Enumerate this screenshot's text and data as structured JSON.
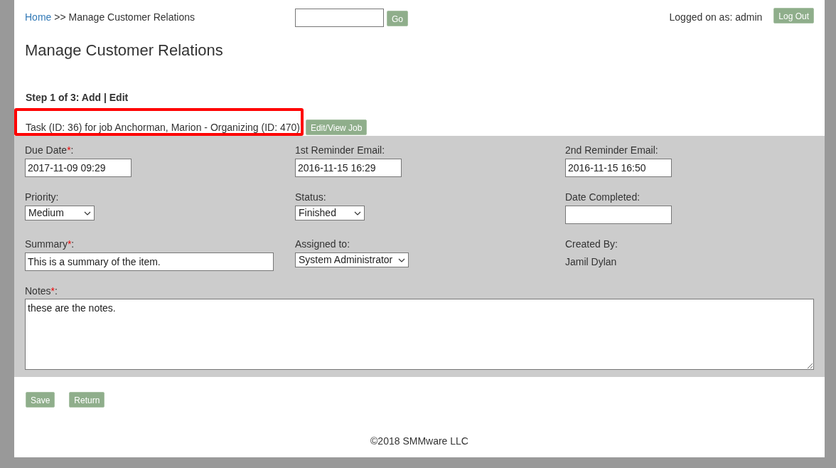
{
  "header": {
    "breadcrumb": {
      "link": "Home",
      "rest": ">> Manage Customer Relations"
    },
    "search_button": "Go",
    "login_text": "Logged on as: admin",
    "logout_button": "Log Out"
  },
  "title": "Manage Customer Relations",
  "step": "Step 1 of 3: Add | Edit",
  "task_line": {
    "text": "Task (ID: 36) for job Anchorman, Marion - Organizing (ID: 470)",
    "button": "Edit/View Job",
    "highlighted": true
  },
  "form": {
    "rows": [
      [
        {
          "kind": "text",
          "label": "Due Date",
          "required_mark": "*",
          "label_end": ":",
          "value": "2017-11-09 09:29"
        },
        {
          "kind": "text",
          "label": "1st Reminder Email:",
          "value": "2016-11-15 16:29"
        },
        {
          "kind": "text",
          "label": "2nd Reminder Email:",
          "value": "2016-11-15 16:50"
        }
      ],
      [
        {
          "kind": "select",
          "label": "Priority:",
          "value": "Medium"
        },
        {
          "kind": "select",
          "label": "Status:",
          "value": "Finished"
        },
        {
          "kind": "text",
          "label": "Date Completed:"
        }
      ],
      [
        {
          "kind": "long_text",
          "label": "Summary",
          "required_mark": "*",
          "label_end": ":",
          "value": "This is a summary of the item."
        },
        {
          "kind": "select",
          "label": "Assigned to:",
          "value": "System Administrator"
        },
        {
          "kind": "static",
          "label": "Created By:",
          "value": "Jamil Dylan"
        }
      ]
    ],
    "notes": {
      "label": "Notes",
      "required_mark": "*",
      "label_end": ":",
      "value": "these are the notes."
    }
  },
  "buttons": [
    "Save",
    "Return"
  ],
  "footer": "©2018 SMMware LLC"
}
